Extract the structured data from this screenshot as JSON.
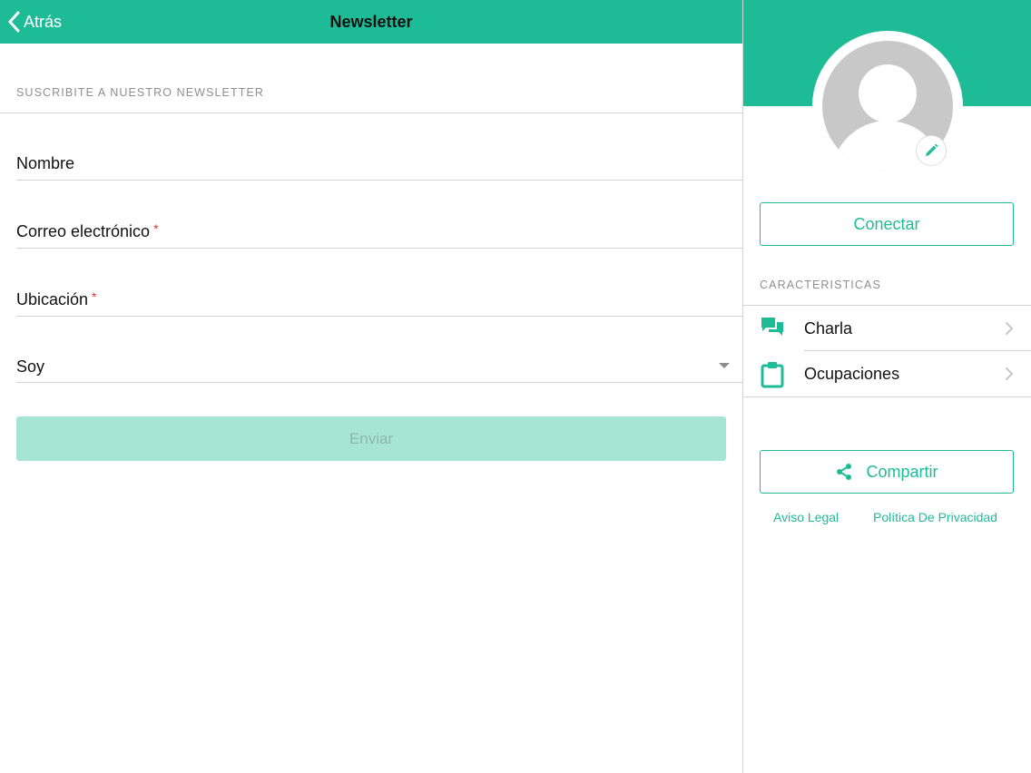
{
  "navbar": {
    "back_label": "Atrás",
    "title": "Newsletter"
  },
  "form": {
    "section_header": "SUSCRIBITE A NUESTRO NEWSLETTER",
    "name_label": "Nombre",
    "email_label": "Correo electrónico",
    "email_required": "*",
    "location_label": "Ubicación",
    "location_required": "*",
    "role_label": "Soy",
    "submit_label": "Enviar"
  },
  "profile": {
    "connect_label": "Conectar",
    "features_header": "CARACTERISTICAS",
    "features": [
      {
        "label": "Charla",
        "icon": "chat-icon"
      },
      {
        "label": "Ocupaciones",
        "icon": "clipboard-icon"
      }
    ],
    "share_label": "Compartir",
    "legal_label": "Aviso Legal",
    "privacy_label": "Política De Privacidad"
  },
  "colors": {
    "accent": "#1dbc97",
    "disabled_button": "#a6e5d3",
    "required": "#e0353b"
  }
}
